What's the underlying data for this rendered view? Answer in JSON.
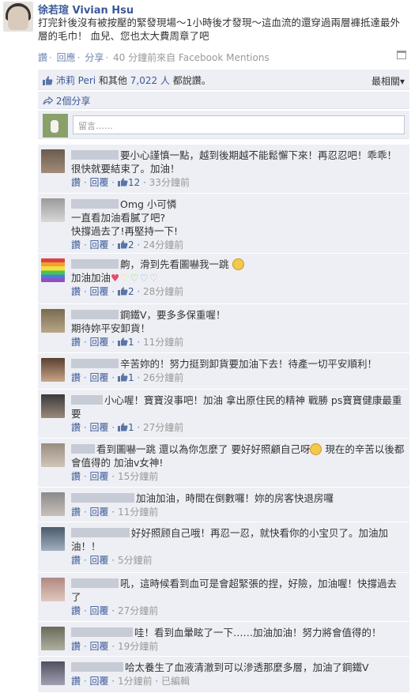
{
  "post": {
    "author": "徐若瑄 Vivian Hsu",
    "text": "打完針後沒有被按壓的緊發現場～1小時後才發現～這血流的還穿過兩層褲抵達最外層的毛巾！ 血兒、您也太大費周章了吧",
    "actions": {
      "like": "讚",
      "comment": "回應",
      "share": "分享",
      "meta": "40 分鐘前來自 Facebook Mentions"
    }
  },
  "feedback": {
    "likes_prefix": "沛莉 Peri",
    "likes_mid": " 和其他 ",
    "likes_count": "7,022 人",
    "likes_suffix": " 都說讚。",
    "sort": "最相關▾",
    "shares": "2個分享",
    "compose_placeholder": "留言……"
  },
  "comments": [
    {
      "text": "要小心謹慎一點，越到後期越不能鬆懈下來！再忍忍吧！乖乖！很快就要結束了。加油！",
      "like": "讚",
      "reply": "回覆",
      "likes": "12",
      "time": "33分鐘前"
    },
    {
      "text": "Omg 小可憐\n一直看加油看膩了吧?\n快撐過去了!再堅持一下!",
      "like": "讚",
      "reply": "回覆",
      "likes": "2",
      "time": "24分鐘前"
    },
    {
      "text": "齁，滑到先看圖嚇我一跳",
      "text2": "加油加油",
      "like": "讚",
      "reply": "回覆",
      "likes": "2",
      "time": "28分鐘前"
    },
    {
      "text": "鋼鐵V，要多多保重喔！\n期待妳平安卸貨！",
      "like": "讚",
      "reply": "回覆",
      "likes": "1",
      "time": "11分鐘前"
    },
    {
      "text": "辛苦妳的！努力挺到卸貨要加油下去！待產一切平安順利！",
      "like": "讚",
      "reply": "回覆",
      "likes": "1",
      "time": "26分鐘前"
    },
    {
      "text": "小心喔！寶寶沒事吧！加油 拿出原住民的精神 戰勝 ps寶寶健康最重要",
      "like": "讚",
      "reply": "回覆",
      "likes": "1",
      "time": "27分鐘前"
    },
    {
      "text": "看到圖嚇一跳 還以為你怎麼了 要好好照顧自己呀",
      "text2": " 現在的辛苦以後都會值得的 加油v女神!",
      "like": "讚",
      "reply": "回覆",
      "time": "15分鐘前"
    },
    {
      "text": "加油加油，時間在倒數囉！妳的房客快退房囉",
      "like": "讚",
      "reply": "回覆",
      "time": "11分鐘前"
    },
    {
      "text": "好好照顾自己哦！再忍一忍，就快看你的小宝贝了。加油加油！！",
      "like": "讚",
      "reply": "回覆",
      "time": "5分鐘前"
    },
    {
      "text": "吼，這時候看到血可是會超緊張的捏，好險，加油喔！快撐過去了",
      "like": "讚",
      "reply": "回覆",
      "time": "27分鐘前"
    },
    {
      "text": "哇！看到血暈眩了一下……加油加油！努力將會值得的！",
      "like": "讚",
      "reply": "回覆",
      "time": "19分鐘前"
    },
    {
      "text": "哈太養生了血液清澈到可以滲透那麼多層，加油了鋼鐵V",
      "like": "讚",
      "reply": "回覆",
      "time": "1分鐘前",
      "edited": "已編輯"
    }
  ]
}
